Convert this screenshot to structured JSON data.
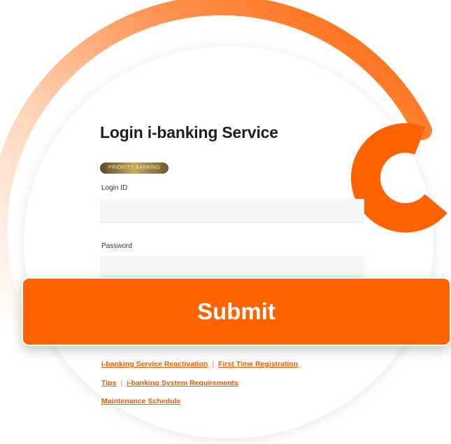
{
  "login": {
    "title": "Login i-banking Service",
    "badge": "PRIORITY BANKING",
    "login_id_label": "Login ID",
    "login_id_value": "",
    "password_label": "Password",
    "password_value": "",
    "submit_label": "Submit"
  },
  "links": {
    "reactivation": "i-banking Service Reactivation",
    "first_time_registration": "First Time Registration",
    "tips": "Tips",
    "system_requirements": "i-banking System Requirements",
    "maintenance_schedule": "Maintenance Schedule",
    "separator": "|"
  },
  "colors": {
    "accent": "#ff6200",
    "link": "#f05a00",
    "title": "#1e1e1e",
    "field_bg": "#f6f6f6"
  }
}
